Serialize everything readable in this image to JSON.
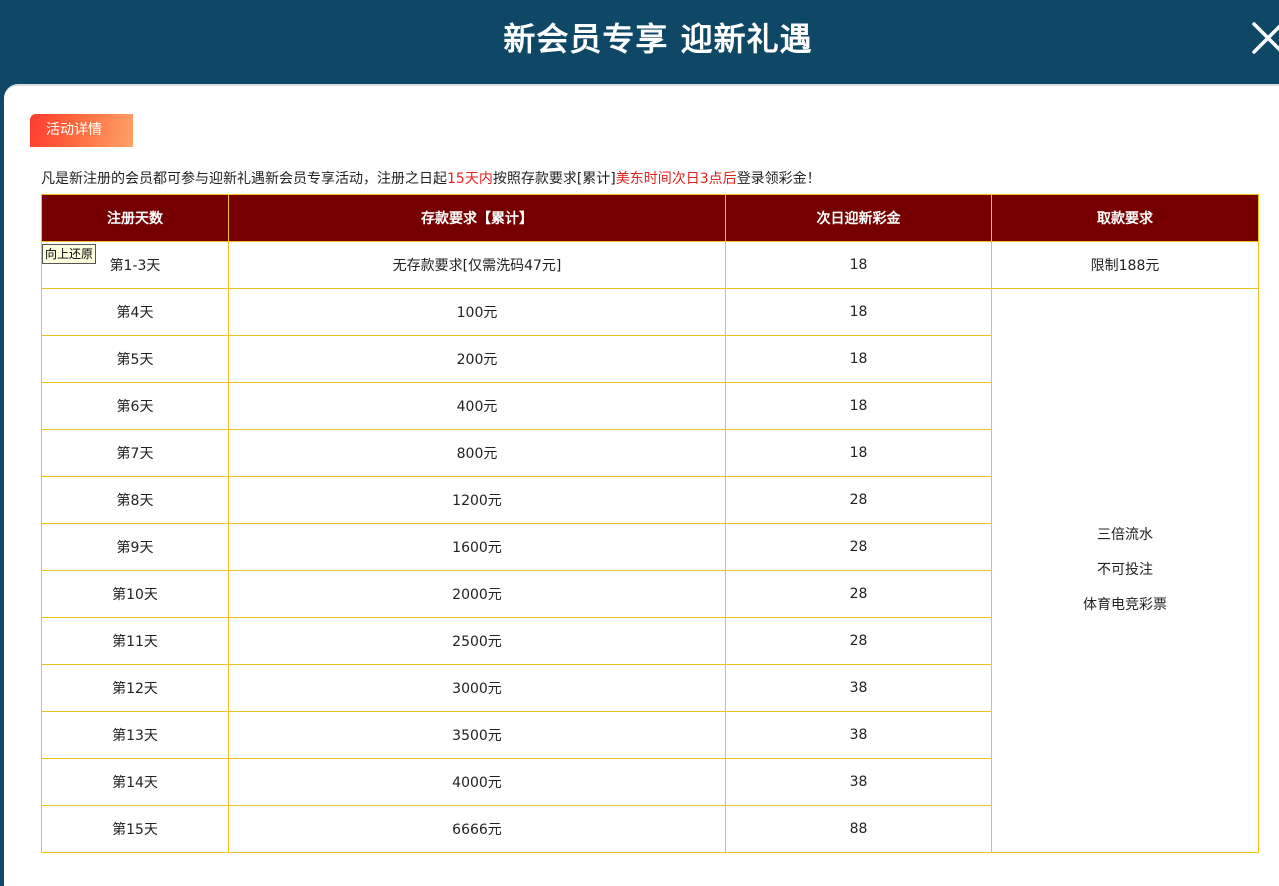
{
  "header": {
    "title": "新会员专享 迎新礼遇",
    "close_icon": "close-icon"
  },
  "tag_label": "活动详情",
  "intro": {
    "prefix": "凡是新注册的会员都可参与迎新礼遇新会员专享活动，注册之日起",
    "highlight1": "15天内",
    "middle": "按照存款要求[累计]",
    "highlight2": "美东时间次日3点后",
    "suffix": "登录领彩金！"
  },
  "colors": {
    "header_bg": "#0e4866",
    "table_header_bg": "#760000",
    "table_border": "#f0c21e",
    "highlight": "#e1221c"
  },
  "table": {
    "headers": [
      "注册天数",
      "存款要求【累计】",
      "次日迎新彩金",
      "取款要求"
    ],
    "first_row": {
      "day": "第1-3天",
      "deposit": "无存款要求[仅需洗码47元]",
      "bonus": "18",
      "withdraw": "限制188元"
    },
    "rows": [
      {
        "day": "第4天",
        "deposit": "100元",
        "bonus": "18"
      },
      {
        "day": "第5天",
        "deposit": "200元",
        "bonus": "18"
      },
      {
        "day": "第6天",
        "deposit": "400元",
        "bonus": "18"
      },
      {
        "day": "第7天",
        "deposit": "800元",
        "bonus": "18"
      },
      {
        "day": "第8天",
        "deposit": "1200元",
        "bonus": "28"
      },
      {
        "day": "第9天",
        "deposit": "1600元",
        "bonus": "28"
      },
      {
        "day": "第10天",
        "deposit": "2000元",
        "bonus": "28"
      },
      {
        "day": "第11天",
        "deposit": "2500元",
        "bonus": "28"
      },
      {
        "day": "第12天",
        "deposit": "3000元",
        "bonus": "38"
      },
      {
        "day": "第13天",
        "deposit": "3500元",
        "bonus": "38"
      },
      {
        "day": "第14天",
        "deposit": "4000元",
        "bonus": "38"
      },
      {
        "day": "第15天",
        "deposit": "6666元",
        "bonus": "88"
      }
    ],
    "withdraw_merged": [
      "三倍流水",
      "不可投注",
      "体育电竞彩票"
    ]
  },
  "tooltip": "向上还原"
}
